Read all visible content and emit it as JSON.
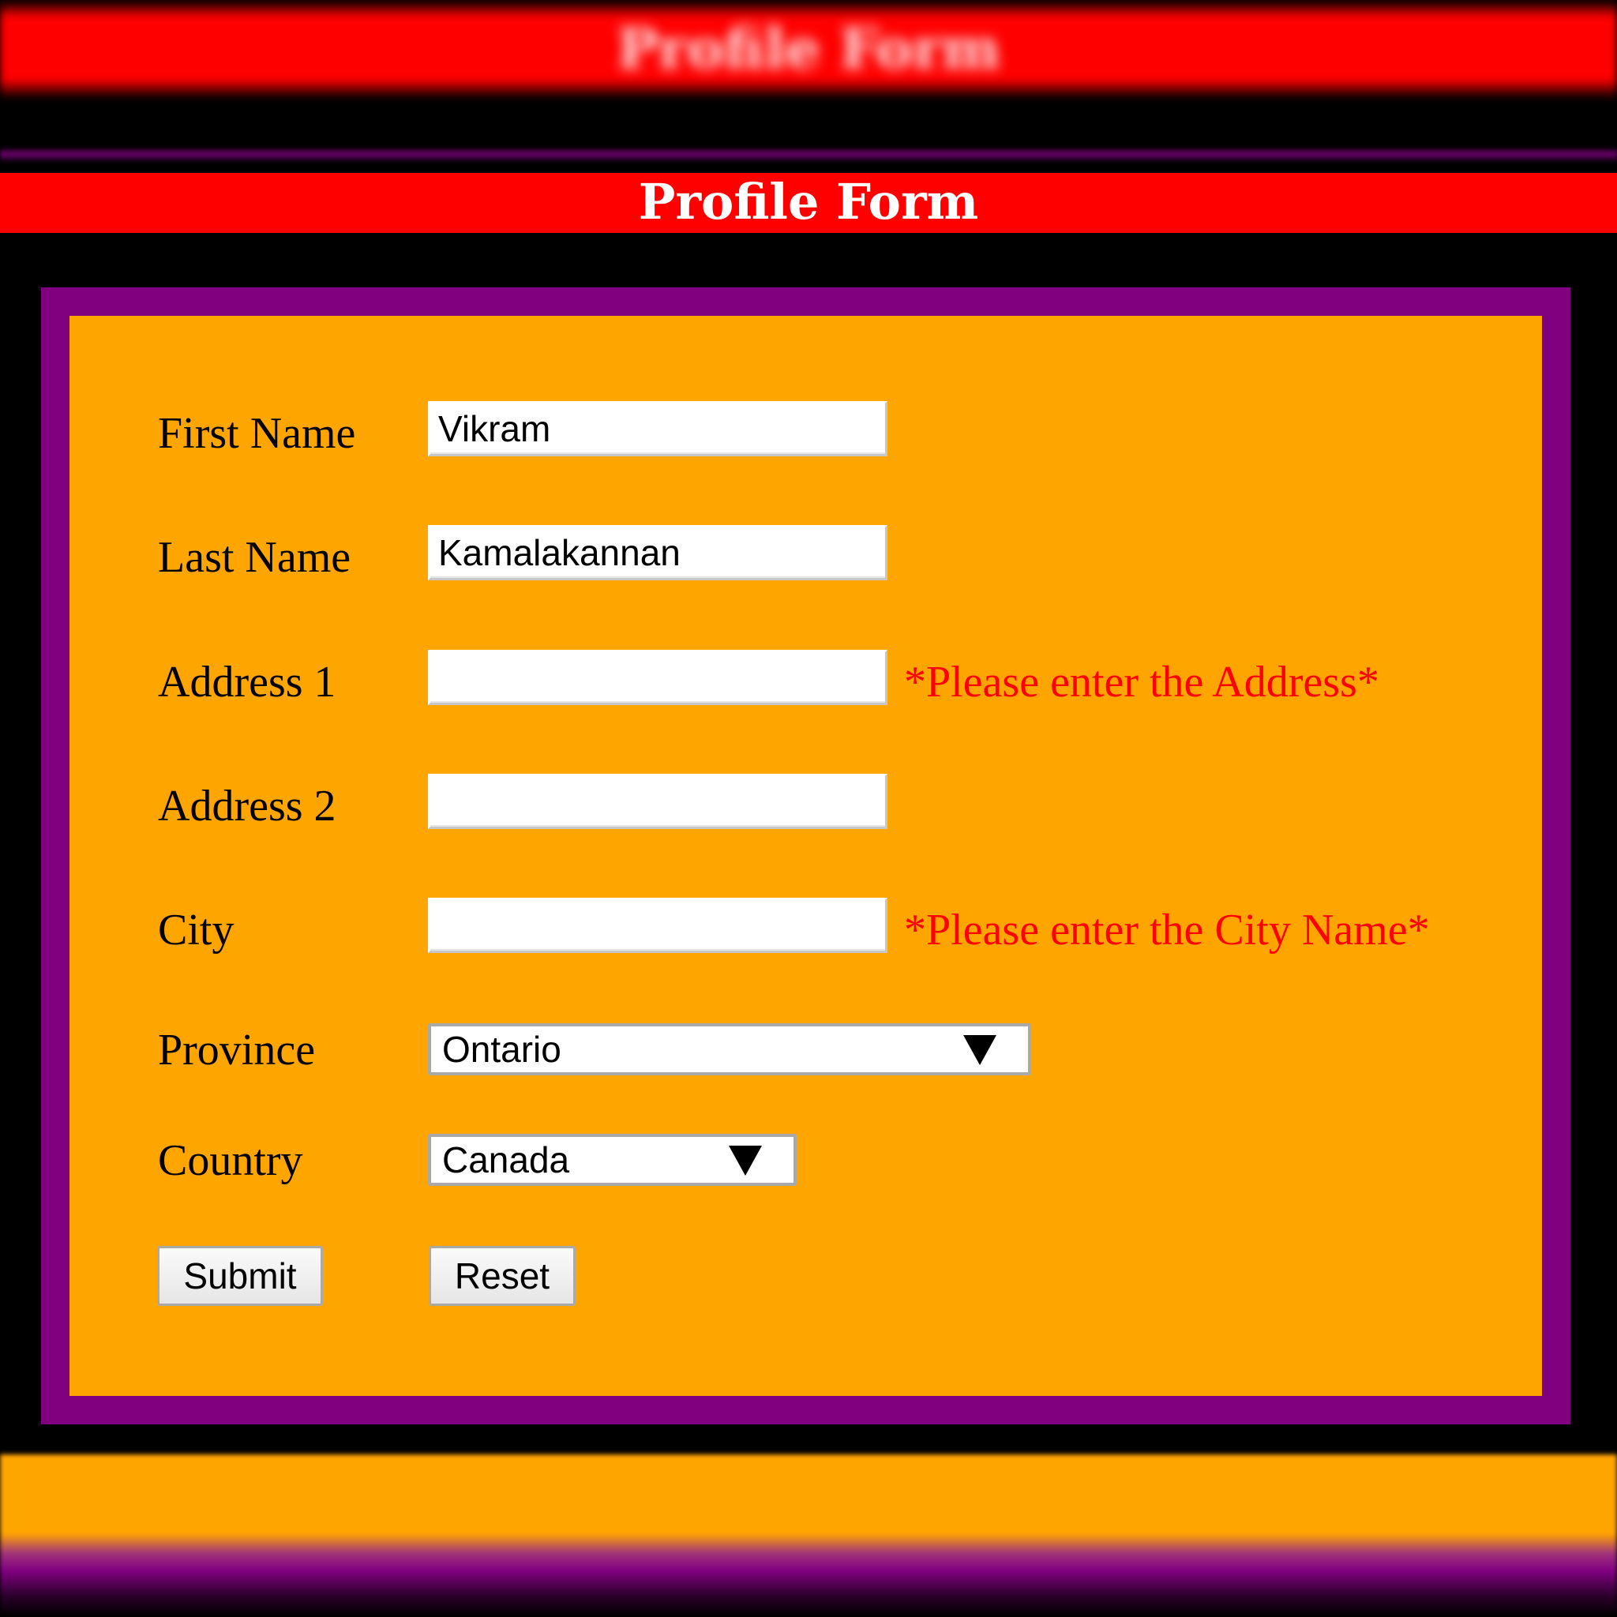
{
  "page": {
    "title": "Profile Form",
    "background": "#000000",
    "title_bar_color": "#ff0000",
    "frame_color": "#800080",
    "panel_color": "#ffa500",
    "error_color": "#ff0000"
  },
  "form": {
    "fields": [
      {
        "label": "First Name",
        "value": "Vikram",
        "error": ""
      },
      {
        "label": "Last Name",
        "value": "Kamalakannan",
        "error": ""
      },
      {
        "label": "Address 1",
        "value": "",
        "error": "*Please enter the Address*"
      },
      {
        "label": "Address 2",
        "value": "",
        "error": ""
      },
      {
        "label": "City",
        "value": "",
        "error": "*Please enter the City Name*"
      }
    ],
    "province": {
      "label": "Province",
      "selected": "Ontario"
    },
    "country": {
      "label": "Country",
      "selected": "Canada"
    },
    "submit_label": "Submit",
    "reset_label": "Reset"
  }
}
